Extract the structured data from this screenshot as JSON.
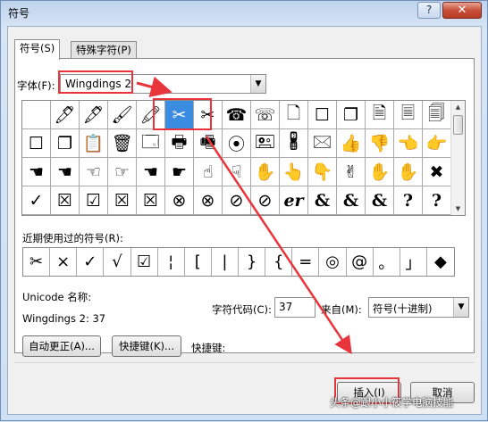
{
  "window": {
    "title": "符号",
    "help_label": "?",
    "close_label": "✕"
  },
  "tabs": [
    {
      "label": "符号(S)",
      "active": true
    },
    {
      "label": "特殊字符(P)",
      "active": false
    }
  ],
  "font": {
    "label": "字体(F):",
    "value": "Wingdings 2"
  },
  "symbol_grid": [
    [
      "",
      "🖊",
      "🖋",
      "🖌",
      "🖍",
      "✂",
      "✂",
      "☎",
      "☏",
      "🗋",
      "☐",
      "❐",
      "🗎",
      "🗏",
      "🗐",
      "🗋"
    ],
    [
      "☐",
      "❐",
      "📋",
      "🗑",
      "🗔",
      "🖶",
      "🖷",
      "⦿",
      "🖭",
      "🖁",
      "🖂",
      "👍",
      "👎",
      "👈",
      "👉",
      ""
    ],
    [
      "☚",
      "☚",
      "☜",
      "☞",
      "☚",
      "☛",
      "☝",
      "☟",
      "✋",
      "👆",
      "👇",
      "✌",
      "✋",
      "✋",
      "✖",
      ""
    ],
    [
      "✓",
      "☒",
      "☑",
      "☒",
      "☒",
      "⊗",
      "⊗",
      "⊘",
      "⊘",
      "er",
      "&",
      "&",
      "&",
      "?",
      "?",
      "?"
    ]
  ],
  "selected_cell_index": 5,
  "recent": {
    "label": "近期使用过的符号(R):",
    "symbols": [
      "✂",
      "×",
      "✓",
      "√",
      "☑",
      "¦",
      "[",
      "|",
      "}",
      "{",
      "=",
      "◎",
      "@",
      "。",
      "」",
      "◆"
    ]
  },
  "unicode": {
    "label": "Unicode 名称:",
    "value": "Wingdings 2: 37"
  },
  "char_code": {
    "label": "字符代码(C):",
    "value": "37"
  },
  "from": {
    "label": "来自(M):",
    "value": "符号(十进制)"
  },
  "buttons": {
    "autocorrect": "自动更正(A)...",
    "shortcut_key": "快捷键(K)...",
    "insert": "插入(I)",
    "cancel": "取消"
  },
  "shortcut_label": "快捷键:",
  "watermark": "头条@跟小小筱学电脑技能",
  "colors": {
    "highlight_red": "#e8343b",
    "selection_blue": "#3a8ce0",
    "close_red": "#c9503a"
  }
}
